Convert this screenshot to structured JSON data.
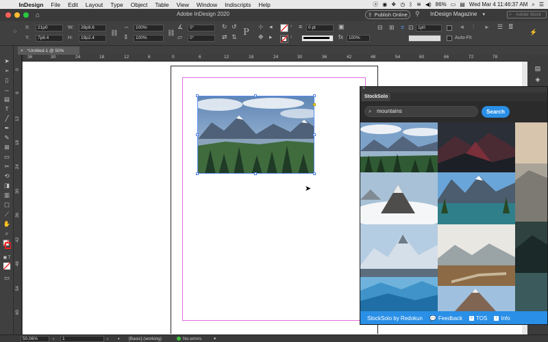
{
  "menubar": {
    "app_name": "InDesign",
    "items": [
      "File",
      "Edit",
      "Layout",
      "Type",
      "Object",
      "Table",
      "View",
      "Window",
      "Indiscripts",
      "Help"
    ],
    "battery": "86%",
    "clock": "Wed Mar 4  11:46:37 AM"
  },
  "appbar": {
    "window_title": "Adobe InDesign 2020",
    "publish_label": "Publish Online",
    "workspace": "InDesign Magazine",
    "search_placeholder": "Adobe Stock"
  },
  "control": {
    "x_label": "X:",
    "x_value": "21p0",
    "y_label": "Y:",
    "y_value": "7p8.4",
    "w_label": "W:",
    "w_value": "28p9.6",
    "h_label": "H:",
    "h_value": "19p2.4",
    "scale_x": "100%",
    "scale_y": "100%",
    "rotate": "0°",
    "shear": "0°",
    "stroke_weight": "0 pt",
    "opacity": "100%",
    "frame_size": "1p0",
    "auto_fit_label": "Auto-Fit"
  },
  "document_tab": {
    "close": "×",
    "label": "*Untitled-1 @ 50%"
  },
  "ruler": {
    "h_ticks": [
      "36",
      "30",
      "24",
      "18",
      "12",
      "6",
      "0",
      "6",
      "12",
      "18",
      "24",
      "30",
      "36",
      "42",
      "48",
      "54",
      "60",
      "66",
      "72",
      "78"
    ],
    "v_ticks": [
      "0",
      "6",
      "12",
      "18",
      "24",
      "30",
      "36",
      "42",
      "48",
      "54",
      "60"
    ]
  },
  "stocksolo": {
    "tab_label": "StockSolo",
    "search_value": "mountains",
    "search_button": "Search",
    "footer_brand": "StockSolo by Redokun",
    "footer_links": [
      "Feedback",
      "TOS",
      "Info"
    ]
  },
  "status": {
    "zoom": "50.06%",
    "page": "1",
    "style": "[Basic] (working)",
    "preflight": "No errors"
  },
  "colors": {
    "accent_blue": "#2a8fe6",
    "margin_magenta": "#e26be2",
    "ui_dark": "#404040"
  }
}
